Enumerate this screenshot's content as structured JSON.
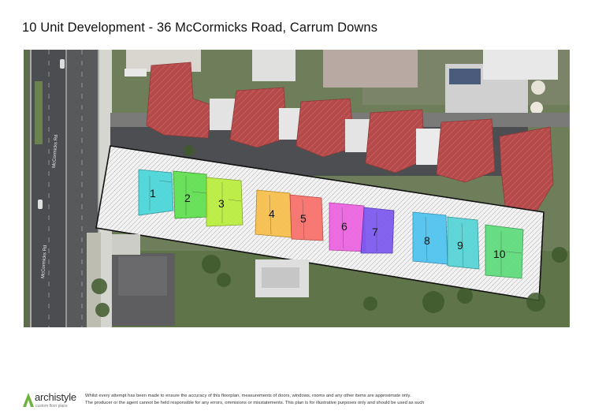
{
  "title": "10 Unit Development - 36 McCormicks Road, Carrum Downs",
  "road_label": "McCormicks Rd",
  "units": [
    {
      "label": "1",
      "color": "#47d6d8"
    },
    {
      "label": "2",
      "color": "#5fe04f"
    },
    {
      "label": "3",
      "color": "#b9ee3c"
    },
    {
      "label": "4",
      "color": "#f8bf4a"
    },
    {
      "label": "5",
      "color": "#f96f6a"
    },
    {
      "label": "6",
      "color": "#ec62e0"
    },
    {
      "label": "7",
      "color": "#7b58ef"
    },
    {
      "label": "8",
      "color": "#4cc3ef"
    },
    {
      "label": "9",
      "color": "#54d4d6"
    },
    {
      "label": "10",
      "color": "#5ddc7a"
    }
  ],
  "footer": {
    "brand": "archistyle",
    "brand_sub": "custom floor plans",
    "disclaimer_1": "Whilst every attempt has been made to ensure the accuracy of this floorplan, measurements of doors, windows, rooms and any other items are approximate only.",
    "disclaimer_2": "The producer or the agent cannot be held responsible for any errors, ommisions or misstatements. This plan is for illustrative purposes only and should be used as such"
  }
}
